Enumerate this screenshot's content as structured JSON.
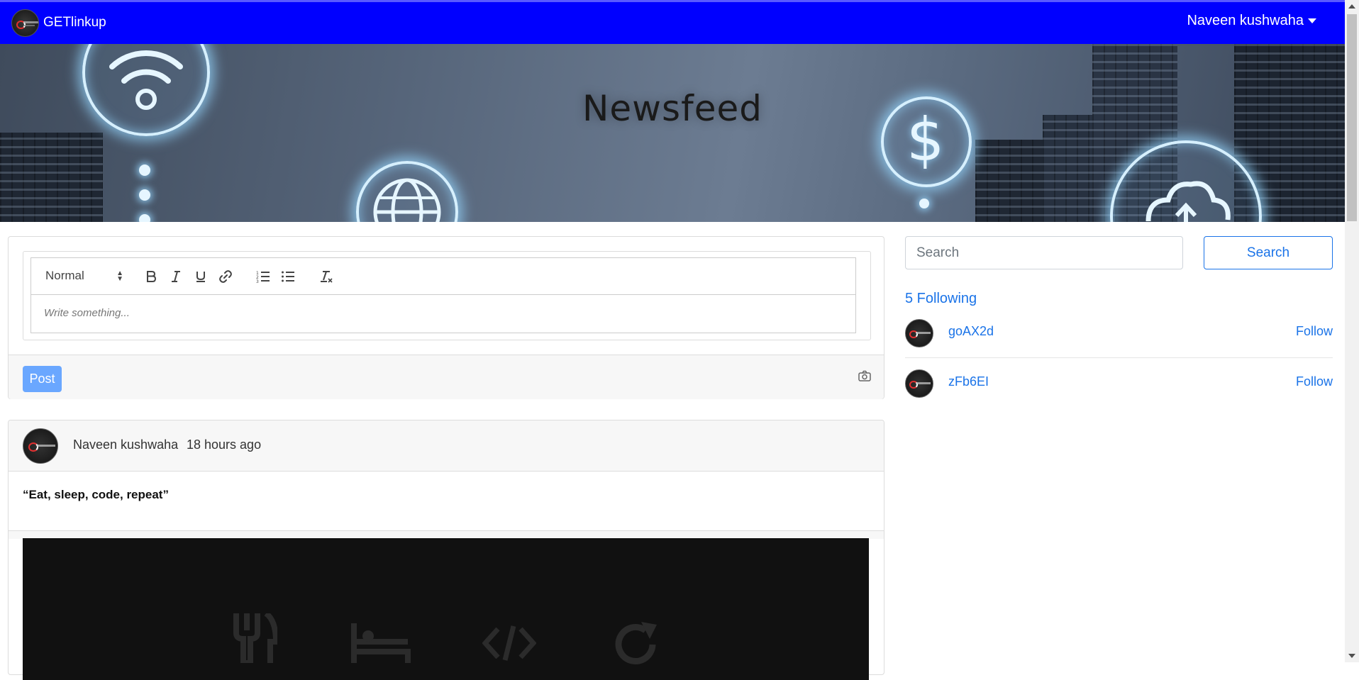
{
  "navbar": {
    "brand": "GETlinkup",
    "user_name": "Naveen kushwaha",
    "bg_color": "#0000ff"
  },
  "banner": {
    "title": "Newsfeed",
    "icons": [
      "wifi-icon",
      "globe-icon",
      "dollar-icon",
      "cloud-icon"
    ]
  },
  "composer": {
    "format_select": "Normal",
    "toolbar_icons": [
      "bold-icon",
      "italic-icon",
      "underline-icon",
      "link-icon",
      "ordered-list-icon",
      "bullet-list-icon",
      "clear-format-icon"
    ],
    "placeholder": "Write something...",
    "post_label": "Post",
    "camera_icon": "camera-icon",
    "post_color": "#6aa7ff"
  },
  "post": {
    "author": "Naveen kushwaha",
    "time": "18 hours ago",
    "text": "“Eat, sleep, code, repeat”",
    "image_icons": [
      "fork-knife-icon",
      "bed-icon",
      "code-icon",
      "repeat-icon"
    ]
  },
  "sidebar": {
    "search_placeholder": "Search",
    "search_button": "Search",
    "following_title": "5 Following",
    "following": [
      {
        "name": "goAX2d",
        "action": "Follow"
      },
      {
        "name": "zFb6EI",
        "action": "Follow"
      }
    ],
    "accent_color": "#1a73e8"
  }
}
